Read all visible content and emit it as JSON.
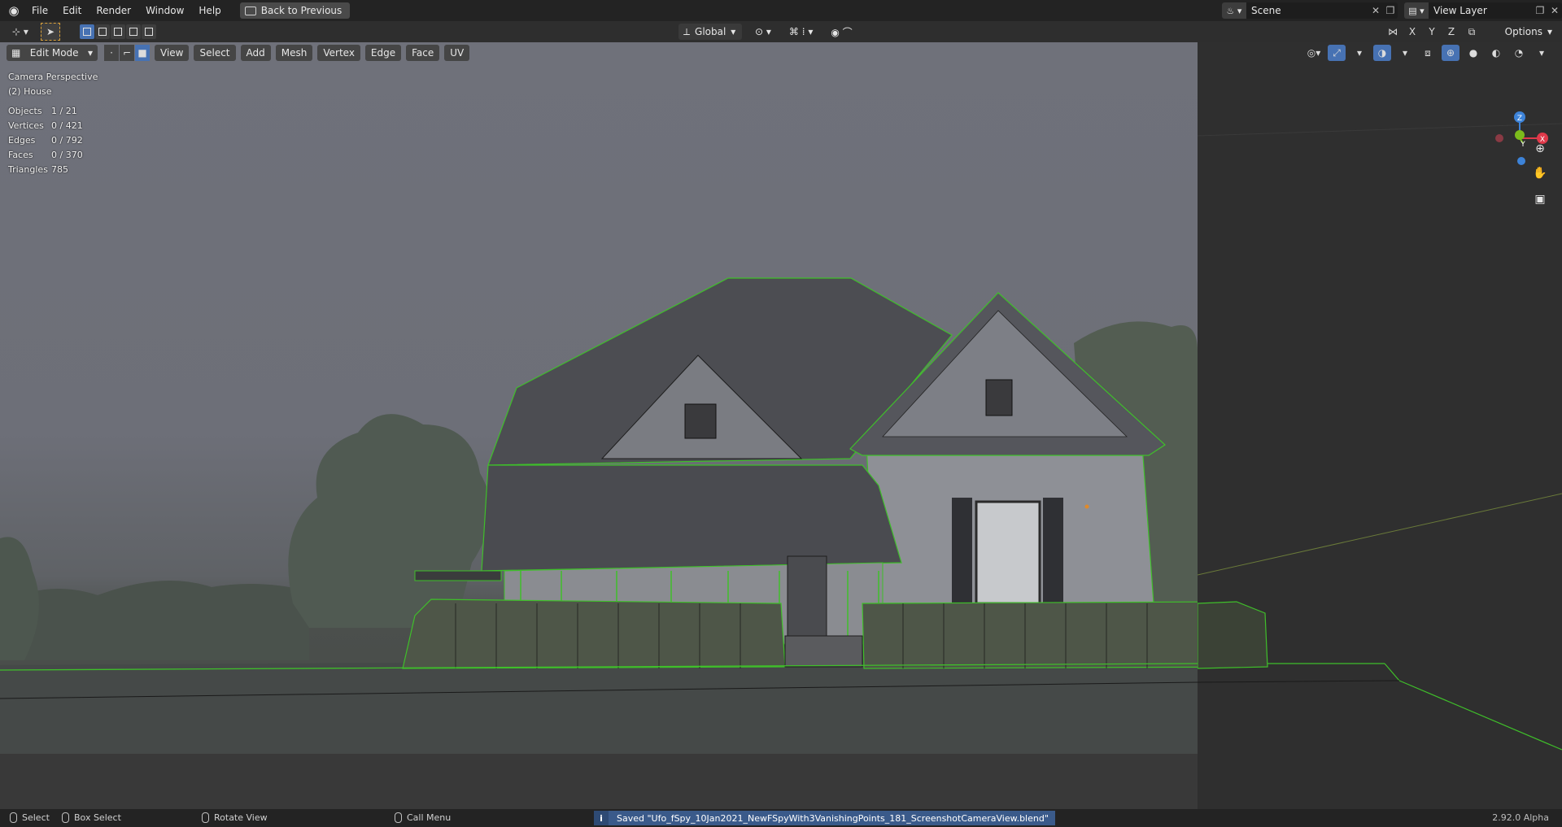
{
  "topbar": {
    "menu": [
      "File",
      "Edit",
      "Render",
      "Window",
      "Help"
    ],
    "back_button": "Back to Previous",
    "scene_name": "Scene",
    "view_layer": "View Layer"
  },
  "header2": {
    "transform_orientation": "Global",
    "options": "Options",
    "axes": [
      "X",
      "Y",
      "Z"
    ]
  },
  "viewport_header": {
    "mode": "Edit Mode",
    "menus": [
      "View",
      "Select",
      "Add",
      "Mesh",
      "Vertex",
      "Edge",
      "Face",
      "UV"
    ]
  },
  "overlay": {
    "view_name": "Camera Perspective",
    "object_name": "(2) House",
    "stats": [
      {
        "label": "Objects",
        "value": "1 / 21"
      },
      {
        "label": "Vertices",
        "value": "0 / 421"
      },
      {
        "label": "Edges",
        "value": "0 / 792"
      },
      {
        "label": "Faces",
        "value": "0 / 370"
      },
      {
        "label": "Triangles",
        "value": "785"
      }
    ]
  },
  "gizmo": {
    "x": "X",
    "y": "Y",
    "z": "Z"
  },
  "statusbar": {
    "select": "Select",
    "box_select": "Box Select",
    "rotate_view": "Rotate View",
    "call_menu": "Call Menu",
    "saved_message": "Saved \"Ufo_fSpy_10Jan2021_NewFSpyWith3VanishingPoints_181_ScreenshotCameraView.blend\"",
    "version": "2.92.0 Alpha"
  },
  "colors": {
    "accent": "#4772b3",
    "axis_x": "#e0394a",
    "axis_y": "#7cbb1b",
    "axis_z": "#3d83d8",
    "wire": "#3fbf2a"
  }
}
